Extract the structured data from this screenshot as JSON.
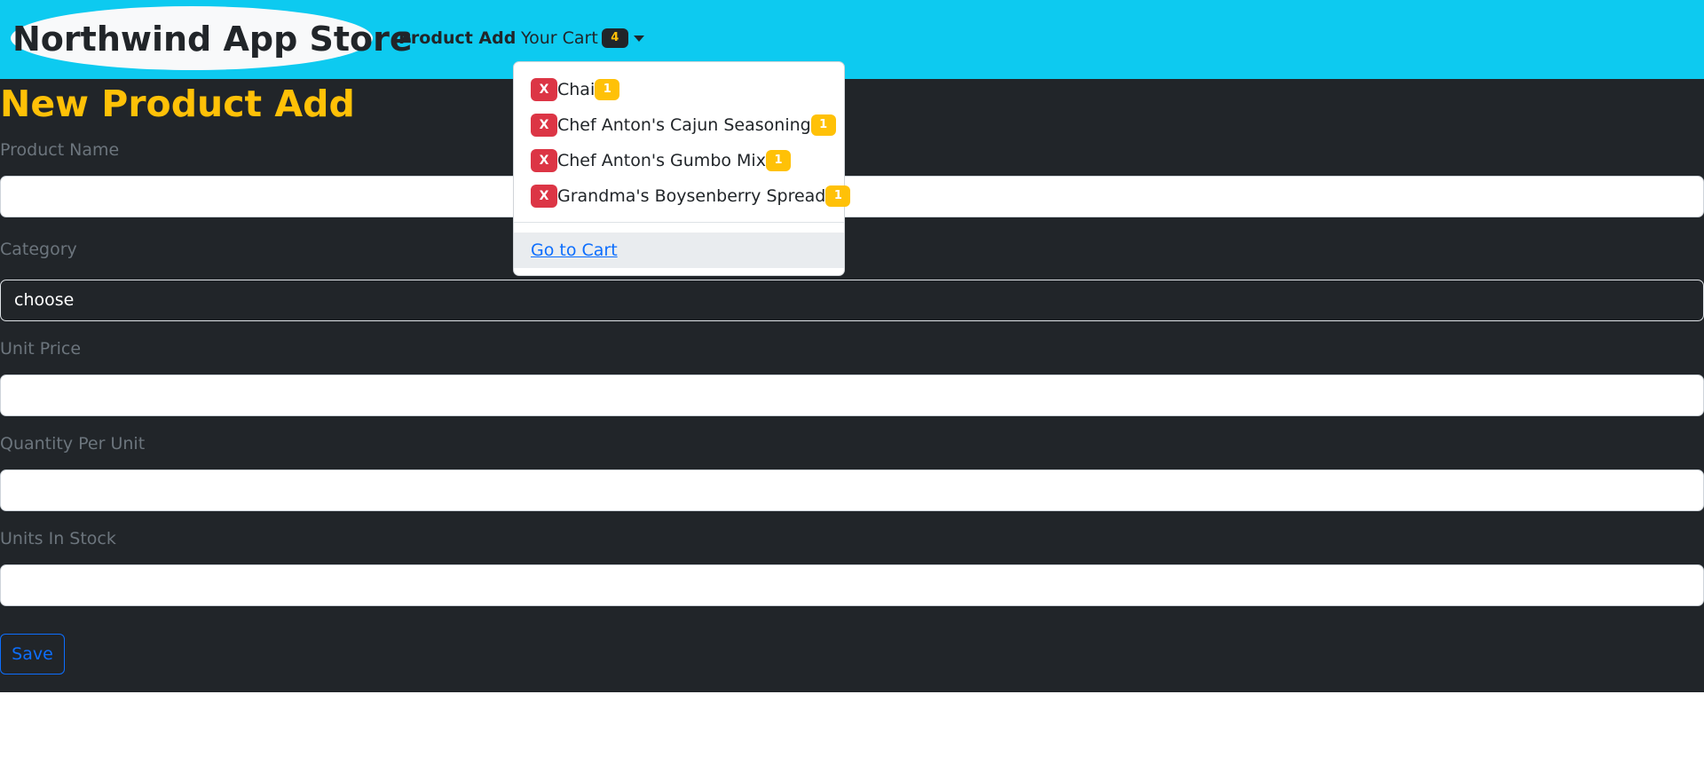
{
  "navbar": {
    "brand": "Northwind App Store",
    "product_add_link": "Product Add",
    "cart_label": "Your Cart",
    "cart_count": "4"
  },
  "cart_dropdown": {
    "items": [
      {
        "remove_label": "X",
        "name": "Chai",
        "quantity": "1"
      },
      {
        "remove_label": "X",
        "name": "Chef Anton's Cajun Seasoning",
        "quantity": "1"
      },
      {
        "remove_label": "X",
        "name": "Chef Anton's Gumbo Mix",
        "quantity": "1"
      },
      {
        "remove_label": "X",
        "name": "Grandma's Boysenberry Spread",
        "quantity": "1"
      }
    ],
    "go_to_cart_label": "Go to Cart"
  },
  "form": {
    "title": "New Product Add",
    "product_name_label": "Product Name",
    "product_name_value": "",
    "category_label": "Category",
    "category_selected": "choose",
    "unit_price_label": "Unit Price",
    "unit_price_value": "",
    "quantity_per_unit_label": "Quantity Per Unit",
    "quantity_per_unit_value": "",
    "units_in_stock_label": "Units In Stock",
    "units_in_stock_value": "",
    "save_label": "Save"
  },
  "colors": {
    "navbar_bg": "#0dcaf0",
    "page_bg": "#212529",
    "title_accent": "#ffc107",
    "danger": "#dc3545",
    "warning": "#ffc107",
    "primary": "#0d6efd"
  }
}
